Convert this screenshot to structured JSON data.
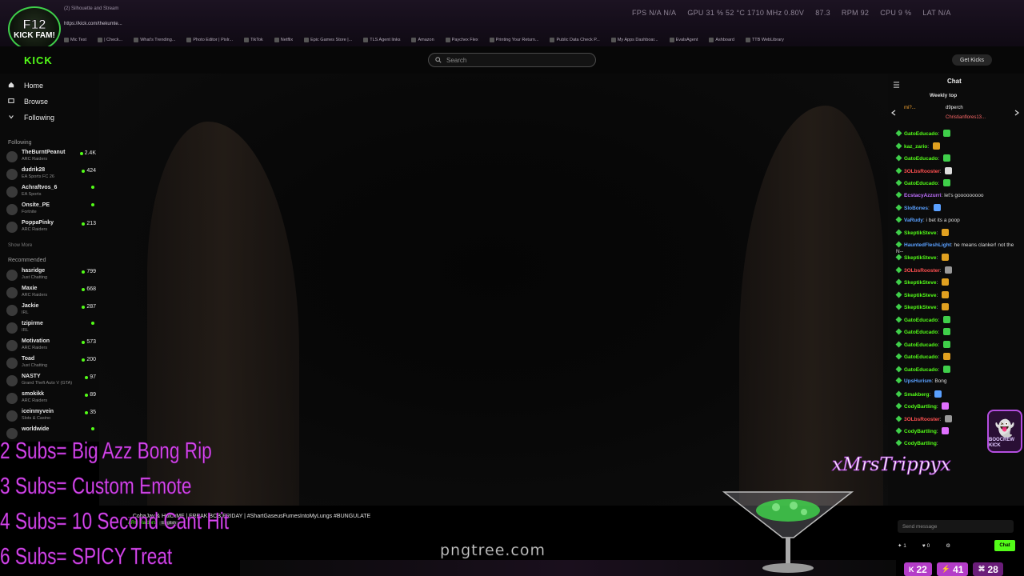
{
  "browser": {
    "tab_title": "(2) Silhouette and Stream",
    "address": "https://kick.com/thekumte...",
    "stats": [
      "FPS N/A N/A",
      "GPU 31 % 52 °C 1710 MHz 0.80V",
      "87.3",
      "RPM 92",
      "CPU 9 %",
      "LAT N/A"
    ],
    "bookmarks": [
      "Mic Test",
      "| Check...",
      "What's Trending...",
      "Photo Editor | Pixlr...",
      "TikTok",
      "Netflix",
      "Epic Games Store |...",
      "TLS Agent links",
      "Amazon",
      "Paychex Flex",
      "Printing Your Return...",
      "Public Data Check P...",
      "My Apps Dashboar...",
      "EvalsAgent",
      "Ashboard",
      "TTB WebLibrary"
    ]
  },
  "channel_logo": {
    "line1": "F12",
    "line2": "KICK FAM!"
  },
  "header": {
    "logo": "KICK",
    "search_placeholder": "Search",
    "get_kicks": "Get Kicks"
  },
  "sidebar": {
    "nav": [
      {
        "label": "Home",
        "icon": "home-icon"
      },
      {
        "label": "Browse",
        "icon": "browse-icon"
      },
      {
        "label": "Following",
        "icon": "chevron-down-icon"
      }
    ],
    "following_heading": "Following",
    "following": [
      {
        "name": "TheBurntPeanut",
        "game": "ARC Raiders",
        "viewers": "2.4K"
      },
      {
        "name": "dudrik28",
        "game": "EA Sports FC 26",
        "viewers": "424"
      },
      {
        "name": "Achraftvos_6",
        "game": "EA Sports",
        "viewers": ""
      },
      {
        "name": "Onsite_PE",
        "game": "Fortnite",
        "viewers": ""
      },
      {
        "name": "PoppaPinky",
        "game": "ARC Raiders",
        "viewers": "213"
      }
    ],
    "show_more": "Show More",
    "recommended_heading": "Recommended",
    "recommended": [
      {
        "name": "hasridge",
        "game": "Just Chatting",
        "viewers": "799"
      },
      {
        "name": "Maxie",
        "game": "ARC Raiders",
        "viewers": "668"
      },
      {
        "name": "Jackie",
        "game": "IRL",
        "viewers": "287"
      },
      {
        "name": "tzipirme",
        "game": "IRL",
        "viewers": ""
      },
      {
        "name": "Motivation",
        "game": "ARC Raiders",
        "viewers": "573"
      },
      {
        "name": "Toad",
        "game": "Just Chatting",
        "viewers": "200"
      },
      {
        "name": "NASTY",
        "game": "Grand Theft Auto V (GTA)",
        "viewers": "97"
      },
      {
        "name": "smokikk",
        "game": "ARC Raiders",
        "viewers": "89"
      },
      {
        "name": "iceinmyvein",
        "game": "Slots & Casino",
        "viewers": "35"
      },
      {
        "name": "worldwide",
        "game": "",
        "viewers": ""
      }
    ]
  },
  "video": {
    "title": "...CobaJay & HutchMF | FREAK BOB FRIDAY | #ShartGaseusFumesIntoMyLungs #BUNGULATE",
    "category": "ARC Raiders",
    "language": "English"
  },
  "chat": {
    "title": "Chat",
    "weekly_title": "Weekly top",
    "gifters": [
      "mi?...",
      "d9perch",
      "Christianflores13..."
    ],
    "messages": [
      {
        "user": "GatoEducado",
        "text": "",
        "color": "#53fc18",
        "emote": "#3fcf4a"
      },
      {
        "user": "kaz_zario",
        "text": "",
        "color": "#53fc18",
        "emote": "#e0a020"
      },
      {
        "user": "GatoEducado",
        "text": "",
        "color": "#53fc18",
        "emote": "#3fcf4a"
      },
      {
        "user": "3OLbsRooster",
        "text": "",
        "color": "#ff5050",
        "emote": "#ddd"
      },
      {
        "user": "GatoEducado",
        "text": "",
        "color": "#53fc18",
        "emote": "#3fcf4a"
      },
      {
        "user": "EcstacyAzzurri",
        "text": "let's gooooooooo",
        "color": "#c070ff",
        "emote": ""
      },
      {
        "user": "SloBones",
        "text": "",
        "color": "#5aa0ff",
        "emote": "#5aa0ff"
      },
      {
        "user": "VaRudy",
        "text": "i bet its a poop",
        "color": "#5aa0ff",
        "emote": ""
      },
      {
        "user": "SkeptikSteve",
        "text": "",
        "color": "#53fc18",
        "emote": "#e0a020"
      },
      {
        "user": "HauntedFleshLight",
        "text": "he means clanker! not the N--",
        "color": "#5aa0ff",
        "emote": ""
      },
      {
        "user": "SkeptikSteve",
        "text": "",
        "color": "#53fc18",
        "emote": "#e0a020"
      },
      {
        "user": "3OLbsRooster",
        "text": "",
        "color": "#ff5050",
        "emote": "#999"
      },
      {
        "user": "SkeptikSteve",
        "text": "",
        "color": "#53fc18",
        "emote": "#e0a020"
      },
      {
        "user": "SkeptikSteve",
        "text": "",
        "color": "#53fc18",
        "emote": "#e0a020"
      },
      {
        "user": "SkeptikSteve",
        "text": "",
        "color": "#53fc18",
        "emote": "#e0a020"
      },
      {
        "user": "GatoEducado",
        "text": "",
        "color": "#53fc18",
        "emote": "#3fcf4a"
      },
      {
        "user": "GatoEducado",
        "text": "",
        "color": "#53fc18",
        "emote": "#3fcf4a"
      },
      {
        "user": "GatoEducado",
        "text": "",
        "color": "#53fc18",
        "emote": "#3fcf4a"
      },
      {
        "user": "GatoEducado",
        "text": "",
        "color": "#53fc18",
        "emote": "#e0a020"
      },
      {
        "user": "GatoEducado",
        "text": "",
        "color": "#53fc18",
        "emote": "#3fcf4a"
      },
      {
        "user": "UpsHurism",
        "text": "Bong",
        "color": "#5aa0ff",
        "emote": ""
      },
      {
        "user": "Smakberg",
        "text": "",
        "color": "#53fc18",
        "emote": "#5aa0ff"
      },
      {
        "user": "CodyBartling",
        "text": "",
        "color": "#53fc18",
        "emote": "#e070ff"
      },
      {
        "user": "3OLbsRooster",
        "text": "",
        "color": "#ff5050",
        "emote": "#999"
      },
      {
        "user": "CodyBartling",
        "text": "",
        "color": "#53fc18",
        "emote": "#e070ff"
      },
      {
        "user": "CodyBartling",
        "text": "",
        "color": "#53fc18",
        "emote": ""
      }
    ],
    "input_placeholder": "Send message",
    "points": "1",
    "likes": "0",
    "send_label": "Chat"
  },
  "overlay": {
    "sub_goals": [
      "2 Subs= Big Azz Bong Rip",
      "3 Subs= Custom Emote",
      "4 Subs= 10 Second Cant Hit",
      "6 Subs= SPICY Treat"
    ],
    "website": "pngtree.com",
    "streamer_script": "xMrsTrippyx",
    "boocrew": "BOOCREW KICK",
    "counters": [
      {
        "icon": "kick-k-icon",
        "value": "22"
      },
      {
        "icon": "follower-icon",
        "value": "41"
      },
      {
        "icon": "sub-icon",
        "value": "28"
      }
    ]
  },
  "colors": {
    "kick_green": "#53fc18",
    "overlay_purple": "#d84cf0",
    "counter_purple": "#b43cc8",
    "background": "#000000"
  }
}
